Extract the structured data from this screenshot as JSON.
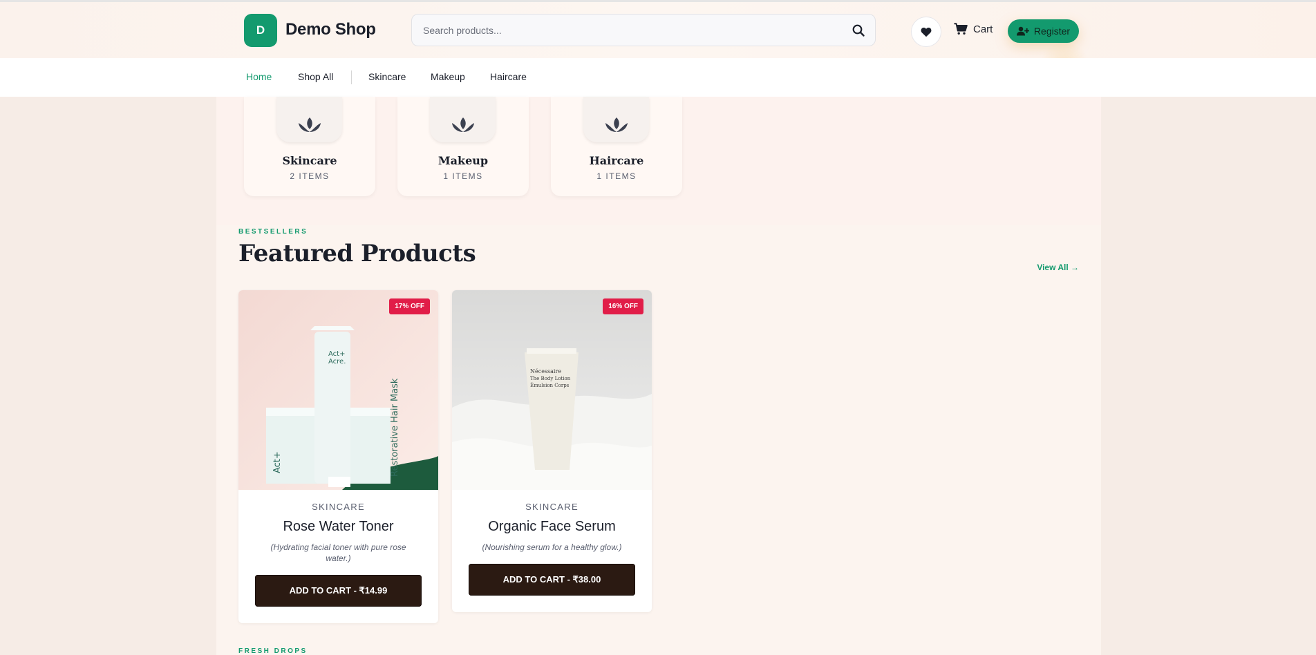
{
  "header": {
    "logo_letter": "D",
    "logo_text": "Demo Shop",
    "search_placeholder": "Search products...",
    "cart_label": "Cart",
    "register_label": "Register"
  },
  "nav": {
    "items": [
      {
        "label": "Home",
        "active": true
      },
      {
        "label": "Shop All"
      },
      {
        "label": "Skincare"
      },
      {
        "label": "Makeup"
      },
      {
        "label": "Haircare"
      }
    ]
  },
  "categories": [
    {
      "name": "Skincare",
      "count": "2 ITEMS"
    },
    {
      "name": "Makeup",
      "count": "1 ITEMS"
    },
    {
      "name": "Haircare",
      "count": "1 ITEMS"
    }
  ],
  "featured": {
    "eyebrow": "BESTSELLERS",
    "title": "Featured Products",
    "view_all": "View All →",
    "products": [
      {
        "badge": "17% OFF",
        "category": "SKINCARE",
        "name": "Rose Water Toner",
        "description": "(Hydrating facial toner with pure rose water.)",
        "button": "ADD TO CART - ₹14.99",
        "image_text": [
          "Act+",
          "Acre.",
          "Restorative Hair Mask"
        ]
      },
      {
        "badge": "16% OFF",
        "category": "SKINCARE",
        "name": "Organic Face Serum",
        "description": "(Nourishing serum for a healthy glow.)",
        "button": "ADD TO CART - ₹38.00",
        "image_text": [
          "Nécessaire",
          "The Body Lotion",
          "Émulsion Corps"
        ]
      }
    ]
  },
  "next_section": {
    "eyebrow": "FRESH DROPS"
  },
  "colors": {
    "brand": "#139a6e",
    "badge": "#e11d48",
    "button": "#2b1a12"
  },
  "icons": [
    "search-icon",
    "heart-icon",
    "cart-icon",
    "add-user-icon",
    "lotus-icon"
  ]
}
